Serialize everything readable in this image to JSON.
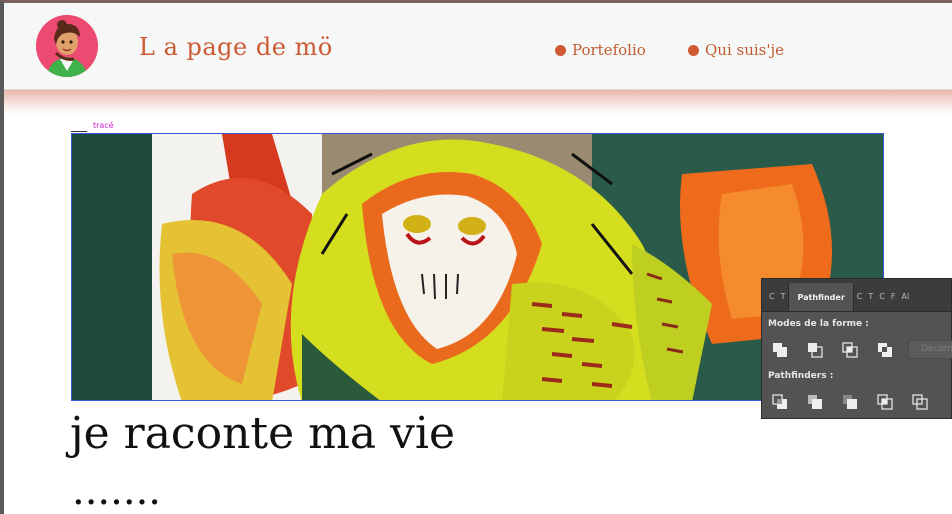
{
  "site": {
    "title": "L a page de mö"
  },
  "nav": {
    "items": [
      {
        "label": "Portefolio"
      },
      {
        "label": "Qui suis'je"
      }
    ]
  },
  "canvas": {
    "trace_label": "tracé"
  },
  "content": {
    "heading": "je raconte ma vie",
    "ellipsis": "......."
  },
  "pathfinder_panel": {
    "tabs": [
      "C",
      "T",
      "Pathfinder",
      "C",
      "T",
      "C",
      "F",
      "Al"
    ],
    "active_tab": "Pathfinder",
    "shape_modes_label": "Modes de la forme :",
    "expand_label": "Décompose",
    "pathfinders_label": "Pathfinders :"
  },
  "colors": {
    "accent": "#cc5a34",
    "nav_dot": "#cf5b34",
    "selection": "#3a57d8",
    "trace_label": "#cc22cc",
    "panel_bg": "#535353"
  }
}
